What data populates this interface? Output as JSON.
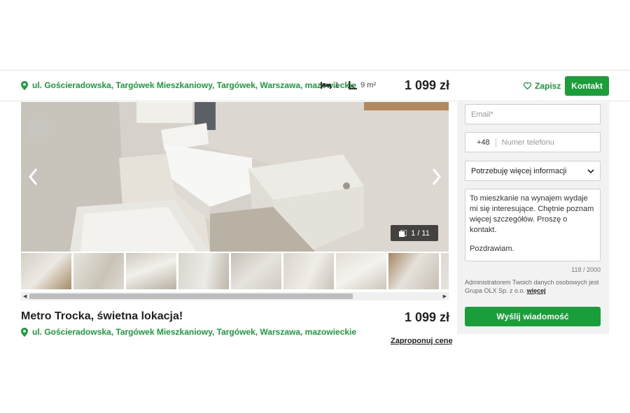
{
  "header": {
    "location": "ul. Gościeradowska, Targówek Mieszkaniowy, Targówek, Warszawa, mazowieckie",
    "beds": "1",
    "area": "9 m²",
    "price": "1 099 zł",
    "save_label": "Zapisz",
    "contact_label": "Kontakt"
  },
  "gallery": {
    "counter": "1 / 11",
    "thumbnail_count": 9
  },
  "listing": {
    "title": "Metro Trocka, świetna lokacja!",
    "price": "1 099 zł",
    "location": "ul. Gościeradowska, Targówek Mieszkaniowy, Targówek, Warszawa, mazowieckie",
    "offer_label": "Zaproponuj cenę"
  },
  "form": {
    "email_placeholder": "Email*",
    "phone_prefix": "+48",
    "phone_placeholder": "Numer telefonu",
    "select_value": "Potrzebuję więcej informacji",
    "message_line1": "To mieszkanie na wynajem wydaje mi się interesujące. Chętnie poznam więcej szczegółów. Proszę o kontakt.",
    "message_line2": "Pozdrawiam.",
    "char_count": "118 / 2000",
    "admin_text": "Administratorem Twoich danych osobowych jest Grupa OLX Sp. z o.o.",
    "admin_link": "więcej",
    "send_label": "Wyślij wiadomość"
  },
  "colors": {
    "accent": "#1a9e3a",
    "sidebar_bg": "#f2f2f2"
  }
}
